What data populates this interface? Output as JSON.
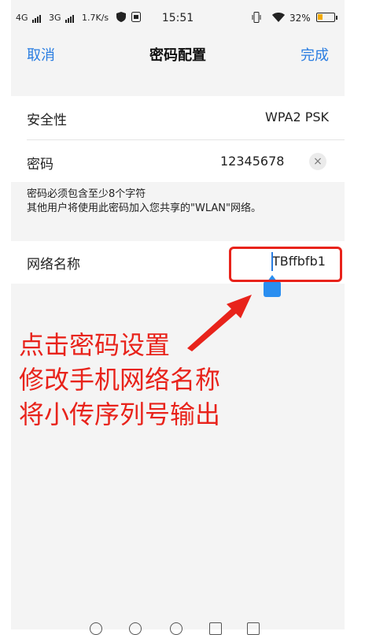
{
  "status_bar": {
    "sig1": "4G",
    "sig2": "3G",
    "speed": "1.7K/s",
    "time": "15:51",
    "battery_pct": "32%",
    "battery_level": 0.32,
    "icons": [
      "signal-icon",
      "shield-icon",
      "sim-icon",
      "vibrate-icon",
      "wifi-icon",
      "battery-icon"
    ]
  },
  "nav": {
    "cancel": "取消",
    "title": "密码配置",
    "done": "完成"
  },
  "security": {
    "label": "安全性",
    "value": "WPA2 PSK"
  },
  "password": {
    "label": "密码",
    "value": "12345678",
    "clear_icon": "×"
  },
  "hint": {
    "line1": "密码必须包含至少8个字符",
    "line2": "其他用户将使用此密码加入您共享的\"WLAN\"网络。"
  },
  "network": {
    "label": "网络名称",
    "value": "TBffbfb1"
  },
  "annotation": {
    "line1": "点击密码设置",
    "line2": "修改手机网络名称",
    "line3": "将小传序列号输出"
  },
  "colors": {
    "accent": "#2a7de1",
    "annotation": "#e8231b",
    "battery": "#f2a900"
  }
}
